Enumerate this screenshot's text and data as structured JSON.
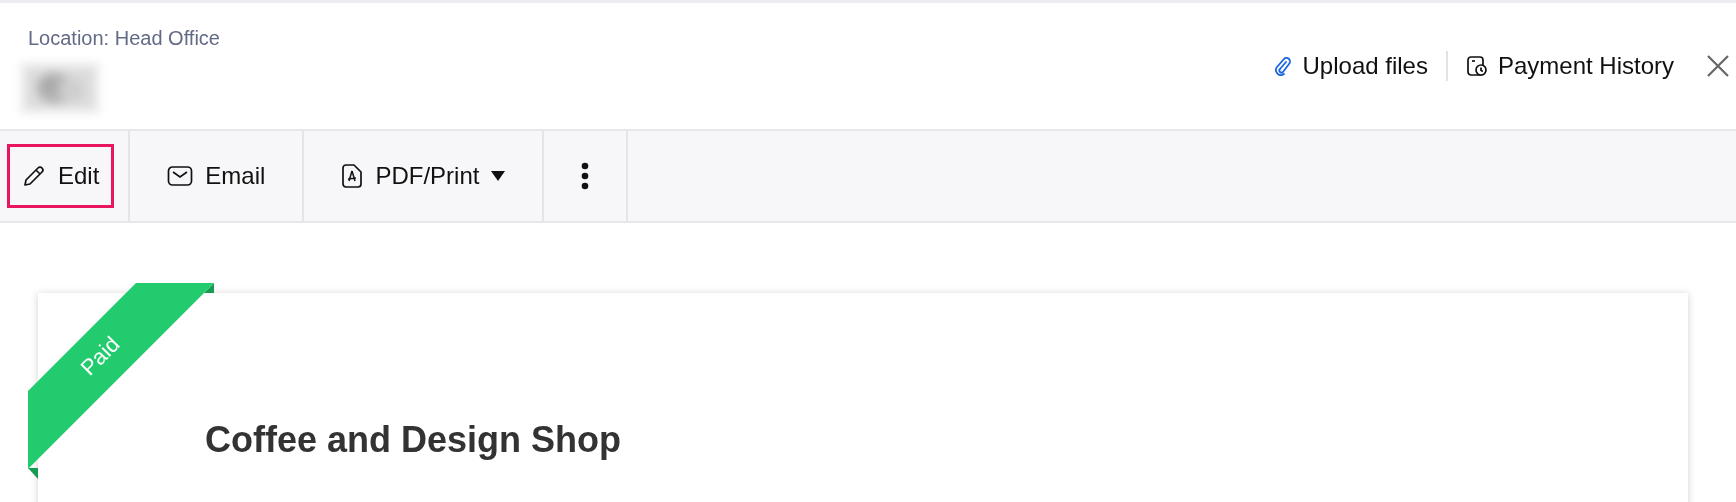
{
  "header": {
    "location": "Location: Head Office",
    "actions": [
      {
        "label": "Upload files",
        "kind": "upload"
      },
      {
        "label": "Payment History",
        "kind": "history"
      }
    ]
  },
  "toolbar": [
    {
      "label": "Edit",
      "kind": "edit",
      "dropdown": false,
      "focused": true
    },
    {
      "label": "Email",
      "kind": "email",
      "dropdown": false,
      "focused": false
    },
    {
      "label": "PDF/Print",
      "kind": "pdf",
      "dropdown": true,
      "focused": false
    },
    {
      "kind": "more",
      "dropdown": false,
      "focused": false
    }
  ],
  "document": {
    "status": "Paid",
    "company": "Coffee and Design Shop"
  }
}
